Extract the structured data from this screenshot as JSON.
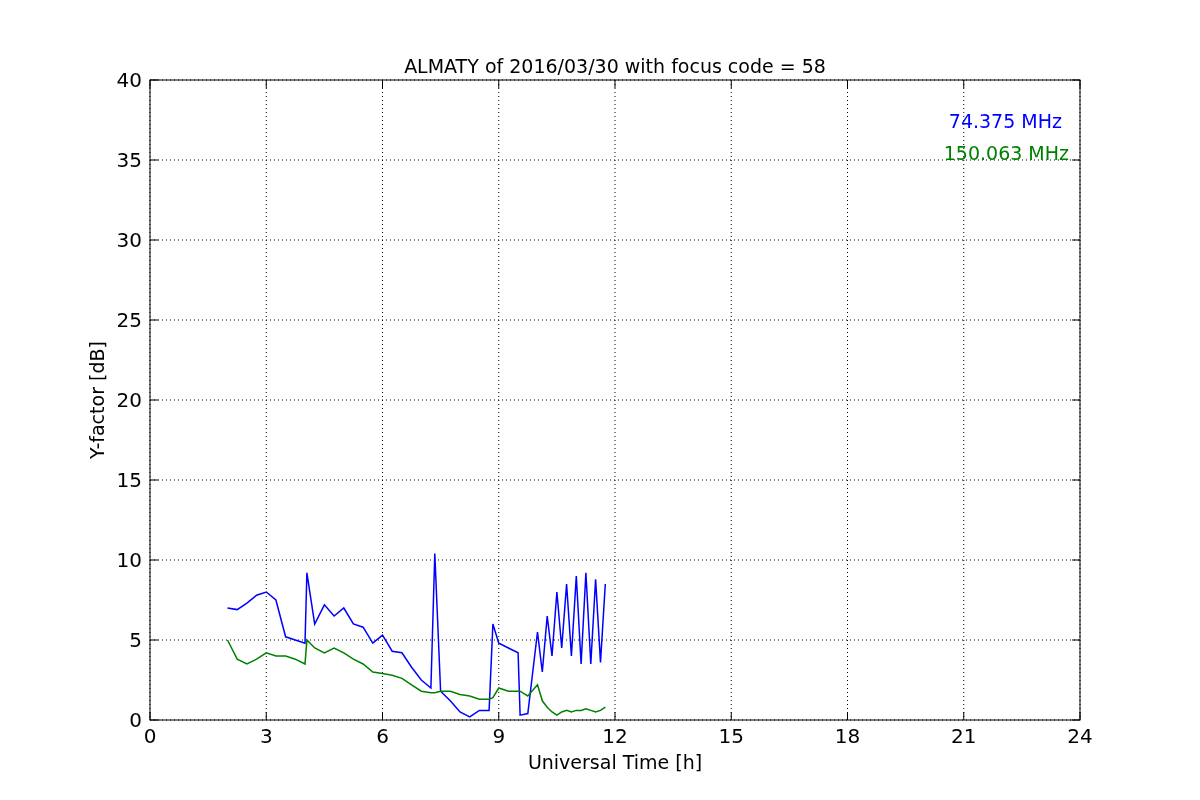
{
  "chart_data": {
    "type": "line",
    "title": "ALMATY of 2016/03/30 with focus code = 58",
    "xlabel": "Universal Time [h]",
    "ylabel": "Y-factor [dB]",
    "x": [
      2,
      2.25,
      2.5,
      2.75,
      3,
      3.25,
      3.5,
      3.75,
      4,
      4.05,
      4.25,
      4.5,
      4.75,
      5,
      5.25,
      5.5,
      5.75,
      6,
      6.25,
      6.5,
      6.75,
      7,
      7.25,
      7.35,
      7.5,
      7.75,
      8,
      8.25,
      8.5,
      8.75,
      8.85,
      9,
      9.25,
      9.5,
      9.55,
      9.75,
      10,
      10.125,
      10.25,
      10.375,
      10.5,
      10.625,
      10.75,
      10.875,
      11,
      11.125,
      11.25,
      11.375,
      11.5,
      11.625,
      11.75
    ],
    "series": [
      {
        "name": "74.375 MHz",
        "color": "#0000ff",
        "values": [
          7,
          6.9,
          7.3,
          7.8,
          8.0,
          7.5,
          5.2,
          5.0,
          4.8,
          9.2,
          6.0,
          7.2,
          6.5,
          7.0,
          6.0,
          5.8,
          4.8,
          5.3,
          4.3,
          4.2,
          3.3,
          2.5,
          2.0,
          10.4,
          1.8,
          1.2,
          0.5,
          0.2,
          0.6,
          0.6,
          6.0,
          4.8,
          4.5,
          4.2,
          0.3,
          0.4,
          5.5,
          3.0,
          6.5,
          4.0,
          8.0,
          4.5,
          8.5,
          4.0,
          9.0,
          3.5,
          9.2,
          3.5,
          8.8,
          3.6,
          8.5
        ]
      },
      {
        "name": "150.063 MHz",
        "color": "#008000",
        "values": [
          5,
          3.8,
          3.5,
          3.8,
          4.2,
          4.0,
          4.0,
          3.8,
          3.5,
          5.0,
          4.5,
          4.2,
          4.5,
          4.2,
          3.8,
          3.5,
          3.0,
          2.9,
          2.8,
          2.6,
          2.2,
          1.8,
          1.7,
          1.7,
          1.8,
          1.8,
          1.6,
          1.5,
          1.3,
          1.3,
          1.4,
          2.0,
          1.8,
          1.8,
          1.8,
          1.5,
          2.2,
          1.2,
          0.8,
          0.5,
          0.3,
          0.5,
          0.6,
          0.5,
          0.6,
          0.6,
          0.7,
          0.6,
          0.5,
          0.6,
          0.8
        ]
      }
    ],
    "grid": true,
    "xlim": [
      0,
      24
    ],
    "ylim": [
      0,
      40
    ],
    "xticks": [
      0,
      3,
      6,
      9,
      12,
      15,
      18,
      21,
      24
    ],
    "yticks": [
      0,
      5,
      10,
      15,
      20,
      25,
      30,
      35,
      40
    ]
  }
}
